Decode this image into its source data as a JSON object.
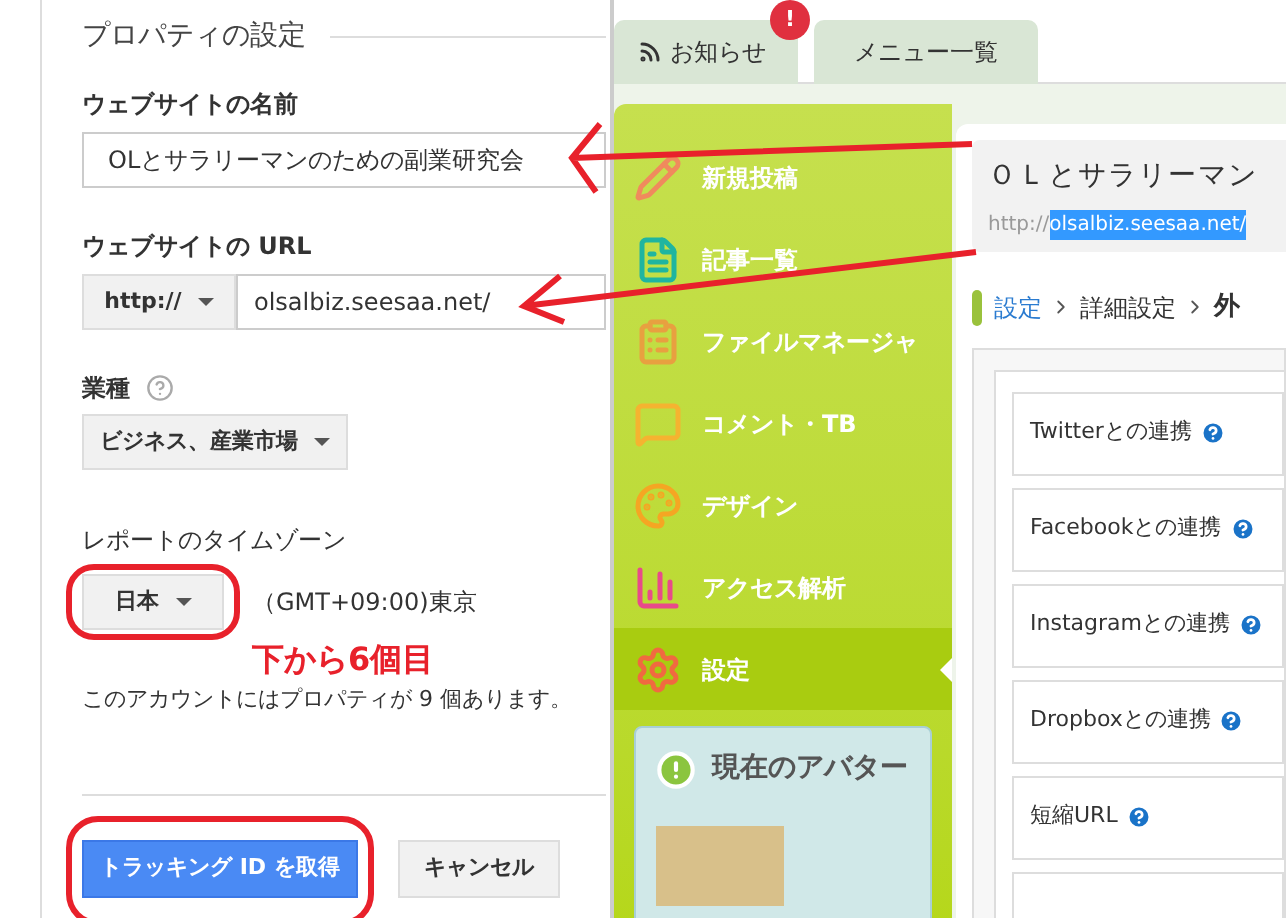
{
  "property_settings": {
    "heading": "プロパティの設定",
    "site_name": {
      "label": "ウェブサイトの名前",
      "value": "OLとサラリーマンのための副業研究会"
    },
    "site_url": {
      "label": "ウェブサイトの URL",
      "scheme": "http://",
      "value": "olsalbiz.seesaa.net/"
    },
    "industry": {
      "label": "業種",
      "value": "ビジネス、産業市場"
    },
    "timezone": {
      "label": "レポートのタイムゾーン",
      "country": "日本",
      "zone": "（GMT+09:00)東京"
    },
    "property_count": "このアカウントにはプロパティが 9 個あります。",
    "buttons": [
      {
        "label": "トラッキング ID を取得",
        "kind": "primary"
      },
      {
        "label": "キャンセル",
        "kind": "secondary"
      }
    ]
  },
  "annotation": {
    "note": "下から6個目"
  },
  "blog_panel": {
    "tabs": [
      {
        "label": "お知らせ",
        "badge": "!"
      },
      {
        "label": "メニュー一覧"
      }
    ],
    "menu": [
      {
        "label": "新規投稿",
        "selected": false
      },
      {
        "label": "記事一覧",
        "selected": false
      },
      {
        "label": "ファイルマネージャ",
        "selected": false
      },
      {
        "label": "コメント・TB",
        "selected": false
      },
      {
        "label": "デザイン",
        "selected": false
      },
      {
        "label": "アクセス解析",
        "selected": false
      },
      {
        "label": "設定",
        "selected": true
      }
    ],
    "avatar": {
      "title": "現在のアバター"
    },
    "site": {
      "title": "ＯＬとサラリーマン",
      "scheme": "http://",
      "url": "olsalbiz.seesaa.net/"
    },
    "breadcrumb": [
      {
        "label": "設定",
        "kind": "link"
      },
      {
        "label": "詳細設定",
        "kind": "plain"
      },
      {
        "label": "外",
        "kind": "current"
      }
    ],
    "settings_items": [
      "Twitterとの連携",
      "Facebookとの連携",
      "Instagramとの連携",
      "Dropboxとの連携",
      "短縮URL"
    ]
  }
}
